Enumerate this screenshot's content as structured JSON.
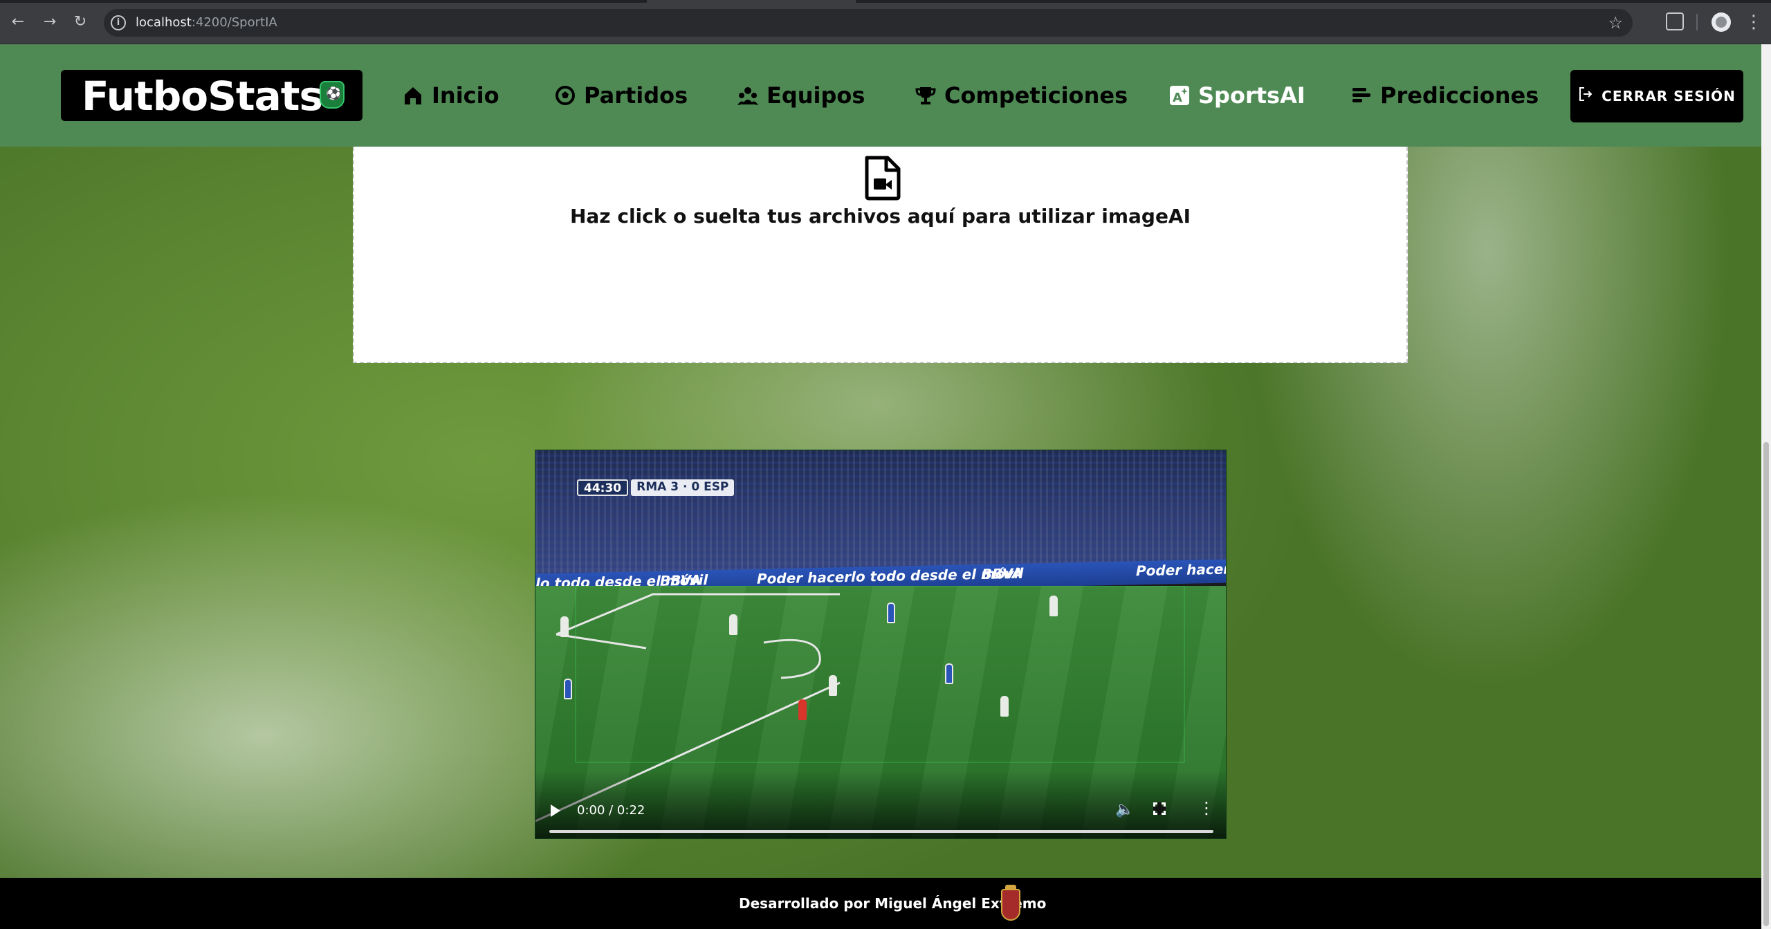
{
  "browser": {
    "url_host": "localhost",
    "url_rest": ":4200/SportIA"
  },
  "header": {
    "brand": "FutboStats",
    "nav": [
      {
        "label": "Inicio",
        "icon": "home-icon"
      },
      {
        "label": "Partidos",
        "icon": "soccer-ball-icon"
      },
      {
        "label": "Equipos",
        "icon": "users-icon"
      },
      {
        "label": "Competiciones",
        "icon": "trophy-icon"
      },
      {
        "label": "SportsAI",
        "icon": "ai-image-icon",
        "active": true
      },
      {
        "label": "Predicciones",
        "icon": "bars-icon"
      }
    ],
    "logout_label": "CERRAR SESIÓN"
  },
  "dropzone": {
    "label": "Haz click o suelta tus archivos aquí para utilizar imageAI"
  },
  "video": {
    "scoreboard_clock": "44:30",
    "scoreboard_score": "RMA 3 · 0 ESP",
    "ad_text_1": "lo todo desde el móvil",
    "ad_text_2": "BBVA",
    "ad_text_3": "Poder hacerlo todo desde el móvil",
    "ad_text_4": "BBVA",
    "ad_text_5": "Poder hacer",
    "time": "0:00 / 0:22",
    "progress": 0
  },
  "footer": {
    "credit": "Desarrollado por Miguel Ángel Extremo"
  },
  "colors": {
    "header_green": "#4f8a55",
    "active_nav": "#ffffff",
    "footer_bg": "#000000"
  }
}
